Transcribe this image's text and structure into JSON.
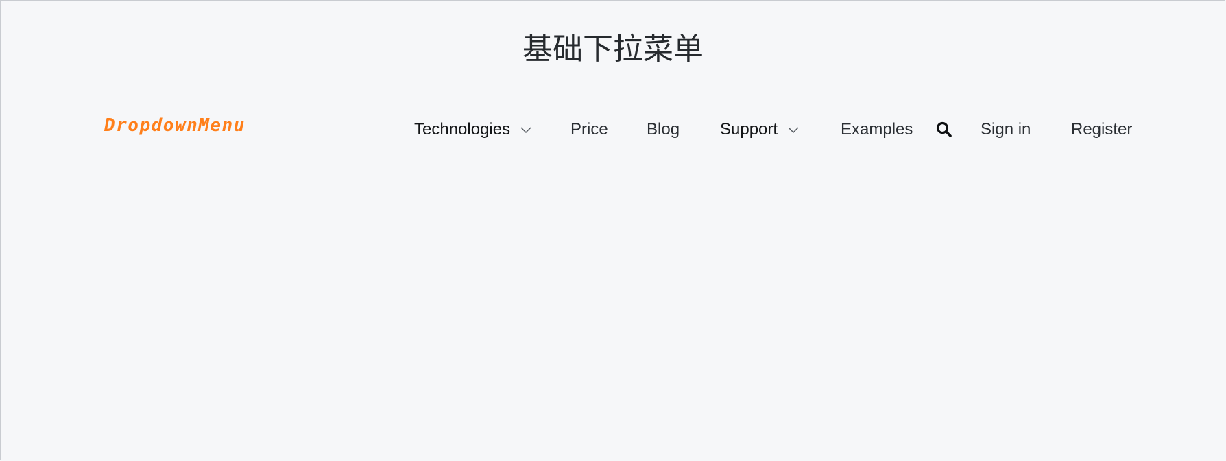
{
  "page": {
    "title": "基础下拉菜单"
  },
  "navbar": {
    "brand": "DropdownMenu",
    "items": [
      {
        "label": "Technologies",
        "has_dropdown": true,
        "icon": "chevron-down-icon"
      },
      {
        "label": "Price",
        "has_dropdown": false
      },
      {
        "label": "Blog",
        "has_dropdown": false
      },
      {
        "label": "Support",
        "has_dropdown": true,
        "icon": "chevron-down-icon"
      },
      {
        "label": "Examples",
        "has_dropdown": false
      }
    ],
    "search_icon": "search-icon",
    "sign_in": "Sign in",
    "register": "Register"
  },
  "colors": {
    "background": "#f6f7f9",
    "brand": "#ff7f1a",
    "text": "#2a2e33"
  }
}
